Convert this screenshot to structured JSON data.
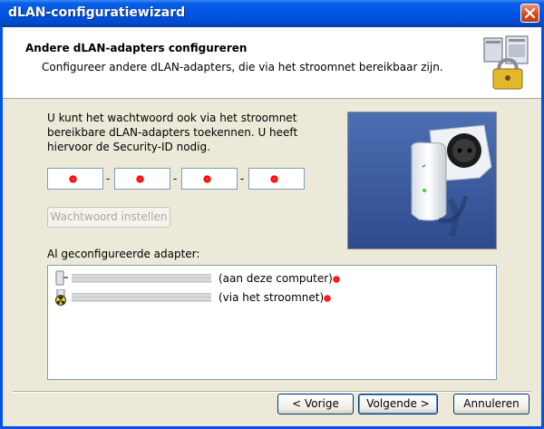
{
  "window": {
    "title": "dLAN-configuratiewizard"
  },
  "header": {
    "title": "Andere dLAN-adapters configureren",
    "subtitle": "Configureer andere dLAN-adapters, die via het stroomnet bereikbaar zijn."
  },
  "intro": {
    "text": "U kunt het wachtwoord ook via het stroomnet bereikbare dLAN-adapters toekennen. U heeft hiervoor de Security-ID nodig."
  },
  "security_id": {
    "separator": "-",
    "fields": [
      "",
      "",
      "",
      ""
    ]
  },
  "buttons": {
    "set_password": "Wachtwoord instellen",
    "back": "< Vorige",
    "next": "Volgende >",
    "cancel": "Annuleren"
  },
  "adapters": {
    "label": "Al geconfigureerde adapter:",
    "items": [
      {
        "status": "(aan deze computer)",
        "icon": "adapter-computer-icon"
      },
      {
        "status": "(via het stroomnet)",
        "icon": "adapter-powerline-icon"
      }
    ]
  },
  "colors": {
    "titlebar": "#0054e3",
    "marker": "#ff0000",
    "dialog": "#ece9d8"
  }
}
